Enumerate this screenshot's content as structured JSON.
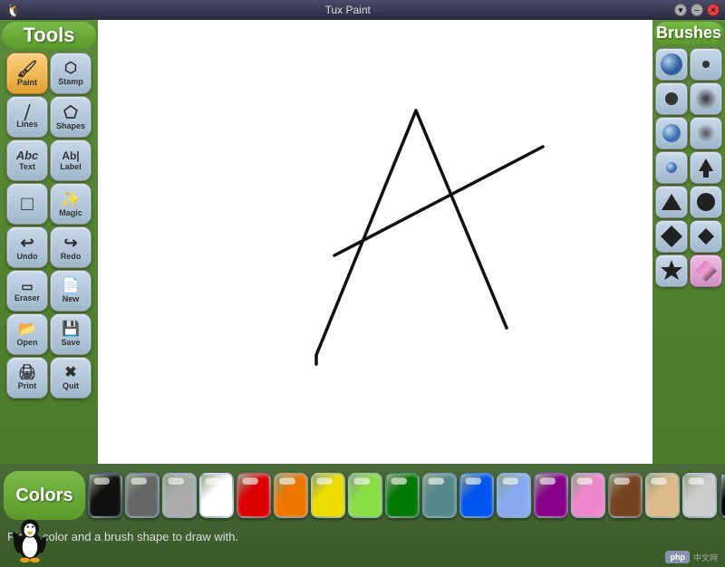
{
  "titlebar": {
    "title": "Tux Paint",
    "logo": "🐧"
  },
  "tools": {
    "header": "Tools",
    "buttons": [
      {
        "id": "paint",
        "label": "Paint",
        "icon": "🖌️"
      },
      {
        "id": "stamp",
        "label": "Stamp",
        "icon": "🔖"
      },
      {
        "id": "lines",
        "label": "Lines",
        "icon": "╱"
      },
      {
        "id": "shapes",
        "label": "Shapes",
        "icon": "⬠"
      },
      {
        "id": "text",
        "label": "Text",
        "icon": "Abc"
      },
      {
        "id": "label",
        "label": "Label",
        "icon": "Ab|"
      },
      {
        "id": "fill",
        "label": "",
        "icon": "□"
      },
      {
        "id": "magic",
        "label": "Magic",
        "icon": "✨"
      },
      {
        "id": "undo",
        "label": "Undo",
        "icon": "↩"
      },
      {
        "id": "redo",
        "label": "Redo",
        "icon": "↪"
      },
      {
        "id": "eraser",
        "label": "Eraser",
        "icon": "⬛"
      },
      {
        "id": "new",
        "label": "New",
        "icon": "📄"
      },
      {
        "id": "open",
        "label": "Open",
        "icon": "📂"
      },
      {
        "id": "save",
        "label": "Save",
        "icon": "💾"
      },
      {
        "id": "print",
        "label": "Print",
        "icon": "🖨️"
      },
      {
        "id": "quit",
        "label": "Quit",
        "icon": "✖"
      }
    ]
  },
  "brushes": {
    "header": "Brushes",
    "items": [
      {
        "id": "b1",
        "shape": "circle-large",
        "color": "#6090c0"
      },
      {
        "id": "b2",
        "shape": "dot-small",
        "color": "#6090c0"
      },
      {
        "id": "b3",
        "shape": "dot-medium",
        "color": "#6090c0"
      },
      {
        "id": "b4",
        "shape": "dot-large-blur",
        "color": "#6090c0"
      },
      {
        "id": "b5",
        "shape": "circle-outline",
        "color": "#6090c0"
      },
      {
        "id": "b6",
        "shape": "blur-dot",
        "color": "#6090c0"
      },
      {
        "id": "b7",
        "shape": "solid-circle",
        "color": "#222"
      },
      {
        "id": "b8",
        "shape": "spray",
        "color": "#6090c0"
      },
      {
        "id": "b9",
        "shape": "up-arrow",
        "color": "#222"
      },
      {
        "id": "b10",
        "shape": "triangle",
        "color": "#222"
      },
      {
        "id": "b11",
        "shape": "small-circle",
        "color": "#222"
      },
      {
        "id": "b12",
        "shape": "diamond",
        "color": "#222"
      },
      {
        "id": "b13",
        "shape": "solid-diamond",
        "color": "#222"
      },
      {
        "id": "b14",
        "shape": "star",
        "color": "#222"
      },
      {
        "id": "b15",
        "shape": "filled-diamond",
        "color": "#222"
      },
      {
        "id": "b16",
        "shape": "gradient-sweep",
        "color": "#d070b0"
      }
    ]
  },
  "colors": {
    "label": "Colors",
    "swatches": [
      {
        "id": "black",
        "hex": "#111111"
      },
      {
        "id": "dark-gray",
        "hex": "#666666"
      },
      {
        "id": "gray",
        "hex": "#aaaaaa"
      },
      {
        "id": "white",
        "hex": "#ffffff"
      },
      {
        "id": "red",
        "hex": "#dd0000"
      },
      {
        "id": "orange",
        "hex": "#ee7700"
      },
      {
        "id": "yellow",
        "hex": "#eedd00"
      },
      {
        "id": "light-green",
        "hex": "#88dd44"
      },
      {
        "id": "green",
        "hex": "#007700"
      },
      {
        "id": "teal",
        "hex": "#558888"
      },
      {
        "id": "blue",
        "hex": "#0055ee"
      },
      {
        "id": "light-blue",
        "hex": "#88aaee"
      },
      {
        "id": "purple",
        "hex": "#880088"
      },
      {
        "id": "pink",
        "hex": "#ee88cc"
      },
      {
        "id": "brown",
        "hex": "#774422"
      },
      {
        "id": "skin",
        "hex": "#ddbb88"
      },
      {
        "id": "light-gray2",
        "hex": "#cccccc"
      },
      {
        "id": "black2",
        "hex": "#000000"
      }
    ]
  },
  "status": {
    "message": "Pick a color and a brush shape to draw with."
  }
}
